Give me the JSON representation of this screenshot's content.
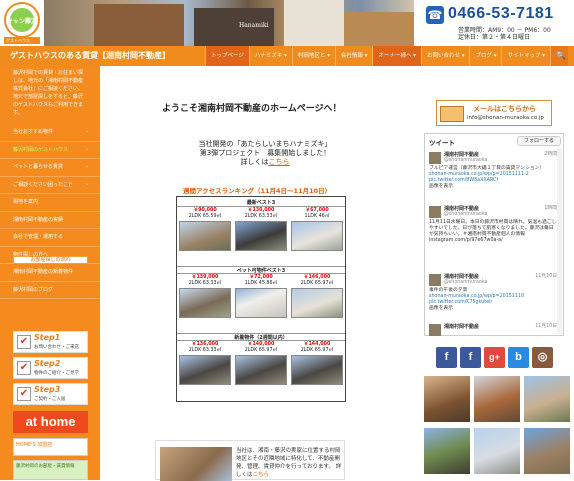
{
  "header": {
    "logo_text": "キャン藤沢",
    "logo_sub": "ゲストハウス",
    "phone": "0466-53-7181",
    "hours_line1": "営業時間：AM9：00 － PM6：00",
    "hours_line2": "定休日：第２・第４日曜日",
    "banner_sign": "Hanamiki"
  },
  "nav": {
    "site_name": "ゲストハウスのある賃貸【湘南村岡不動産】",
    "items": [
      {
        "label": "トップページ"
      },
      {
        "label": "ハナミズキ ▾"
      },
      {
        "label": "村岡地区と ▾"
      },
      {
        "label": "会社情報 ▾"
      },
      {
        "label": "オーナー様へ ▾"
      },
      {
        "label": "お問い合わせ ▾"
      },
      {
        "label": "ブログ ▾"
      },
      {
        "label": "サイトマップ ▾"
      }
    ],
    "search_icon": "🔍"
  },
  "sidebar": {
    "intro": "藤沢村岡での賃貸・お住まい探しは、地元の「湘南村岡不動産株式会社」にご相談ください。地元で部屋探しをすると、藤沢のゲストハウスもご利用できます。",
    "items": [
      {
        "label": "当社おすすめ物件",
        "arrow": "›"
      },
      {
        "label": "藤沢村岡のゲストハウス",
        "arrow": "›"
      },
      {
        "label": "ペットと暮らせる賃貸",
        "arrow": "›"
      },
      {
        "label": "ご相談ください困ったこと",
        "arrow": "›"
      },
      {
        "label": "現地を案内",
        "arrow": ""
      },
      {
        "label": "湘南村岡不動産の実績",
        "arrow": ""
      },
      {
        "label": "会社で管理・運用する",
        "arrow": ""
      },
      {
        "label": "物件探しの方へ",
        "arrow": ""
      },
      {
        "label": "湘南村岡不動産の新着物件",
        "arrow": ""
      },
      {
        "label": "藤沢村岡のブログ",
        "arrow": ""
      }
    ],
    "banner_title": "お部屋探しの流れ",
    "steps": [
      {
        "title": "Step1",
        "sub": "お問い合わせ・ご来店",
        "check": "✔"
      },
      {
        "title": "Step2",
        "sub": "物件のご紹介・ご見学",
        "check": "✔"
      },
      {
        "title": "Step3",
        "sub": "ご契約・ご入居",
        "check": "✔"
      }
    ],
    "athome": "at home",
    "bottom_banner1": "HOME'S 加盟店",
    "bottom_banner2": "藤沢村岡のお部屋・賃貸情報"
  },
  "main": {
    "welcome": "ようこそ湘南村岡不動産のホームページへ！",
    "project_line1": "当社開発の「あたらしいまちハナミズキ」",
    "project_line2": "第3弾プロジェクト　募集開始しました！",
    "project_line3": "詳しくは",
    "project_link": "こちら",
    "ranking_title": "週間アクセスランキング（11月4日〜11月10日）",
    "ranking_groups": [
      {
        "heading": "最新ベスト3",
        "cells": [
          {
            "price": "￥90,000",
            "plan": "2LDK 65.59㎡"
          },
          {
            "price": "￥130,000",
            "plan": "2LDK 63.33㎡"
          },
          {
            "price": "￥67,000",
            "plan": "1LDK 46㎡"
          }
        ]
      },
      {
        "heading": "ペット可物件ベスト3",
        "cells": [
          {
            "price": "￥139,000",
            "plan": "2LDK 63.33㎡"
          },
          {
            "price": "￥72,000",
            "plan": "1LDK 45.86㎡"
          },
          {
            "price": "￥146,000",
            "plan": "2LDK 65.97㎡"
          }
        ]
      },
      {
        "heading": "新着物件（2週間以内）",
        "cells": [
          {
            "price": "￥136,000",
            "plan": "2LDK 63.33㎡"
          },
          {
            "price": "￥140,000",
            "plan": "2LDK 65.97㎡"
          },
          {
            "price": "￥144,000",
            "plan": "2LDK 65.97㎡"
          }
        ]
      }
    ],
    "bottom_text": "当社は、湘南・藤沢の実家に位置する村岡地区とその近隣地域に特化して、不動産開発、管理、賃貸仲介を行っております。",
    "bottom_more": "詳しくは",
    "bottom_link": "こちら"
  },
  "right": {
    "mail_title": "メールはこちらから",
    "mail_addr": "info@shonan-muraoka.co.jp",
    "tweet_header": "ツイート",
    "follow_label": "フォローする",
    "tweets": [
      {
        "name": "湘南村岡不動産",
        "handle": "@shonanmuraoka",
        "time": "2時間",
        "body": "ブルピア運営（藤沢市大鋸１丁目の賃貸マンション）",
        "link": "shonan-muraoka.co.jp/wp/p=20151111-2",
        "link2": "pic.twitter.com/8W8aXXARCf",
        "media": "画像を表示"
      },
      {
        "name": "湘南村岡不動産",
        "handle": "@shonanmuraoka",
        "time": "1時間",
        "body": "11月11日水曜日。本日の藤沢市村岡は晴れ。気温も過ごしやすいでした。日が落ちて肌寒くなりました。藤沢は毎日が気持ちいい。＃湘南村岡不動産個人の情報 instagram.com/p/97e67w0a-a/",
        "link": "",
        "link2": "",
        "media": ""
      },
      {
        "name": "湘南村岡不動産",
        "handle": "@shonanmuraoka",
        "time": "11月10日",
        "body": "事件の午後の夕景",
        "link": "shonan-muraoka.co.jp/wp/p=20151110",
        "link2": "pic.twitter.com/K75gkutelr",
        "media": "画像を表示"
      },
      {
        "name": "湘南村岡不動産",
        "handle": "",
        "time": "11月10日",
        "body": "",
        "link": "",
        "link2": "",
        "media": ""
      }
    ],
    "social": [
      "f",
      "f",
      "g+",
      "b",
      "◎"
    ]
  },
  "colors": {
    "orange": "#f58a1e",
    "nav_active": "#e0651a",
    "phone_blue": "#1c4f9c",
    "price_red": "#e00000"
  }
}
